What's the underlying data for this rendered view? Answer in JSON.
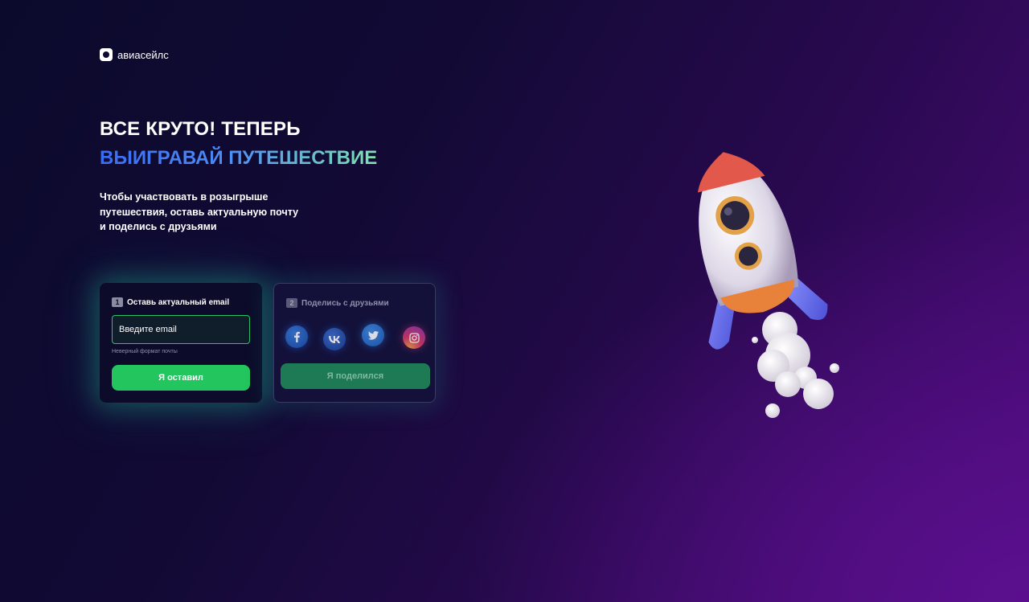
{
  "brand": {
    "name": "авиасейлс"
  },
  "hero": {
    "line1": "ВСЕ КРУТО! ТЕПЕРЬ",
    "line2": "ВЫИГРАВАЙ ПУТЕШЕСТВИЕ",
    "desc_lines": [
      "Чтобы участвовать в розыгрыше",
      "путешествия, оставь актуальную почту",
      "и поделись с друзьями"
    ]
  },
  "step1": {
    "number": "1",
    "title": "Оставь актуальный email",
    "input_placeholder": "Введите email",
    "error": "Неверный формат почты",
    "button": "Я оставил"
  },
  "step2": {
    "number": "2",
    "title": "Поделись с друзьями",
    "socials": [
      {
        "name": "facebook-icon",
        "glyph": "f"
      },
      {
        "name": "vk-icon",
        "glyph": "vk"
      },
      {
        "name": "twitter-icon",
        "glyph": "t"
      },
      {
        "name": "instagram-icon",
        "glyph": "ig"
      }
    ],
    "button": "Я поделился"
  },
  "colors": {
    "accent_green": "#22c55e",
    "gradient_blue": "#3a6cf4",
    "gradient_mint": "#7ee3b0"
  }
}
